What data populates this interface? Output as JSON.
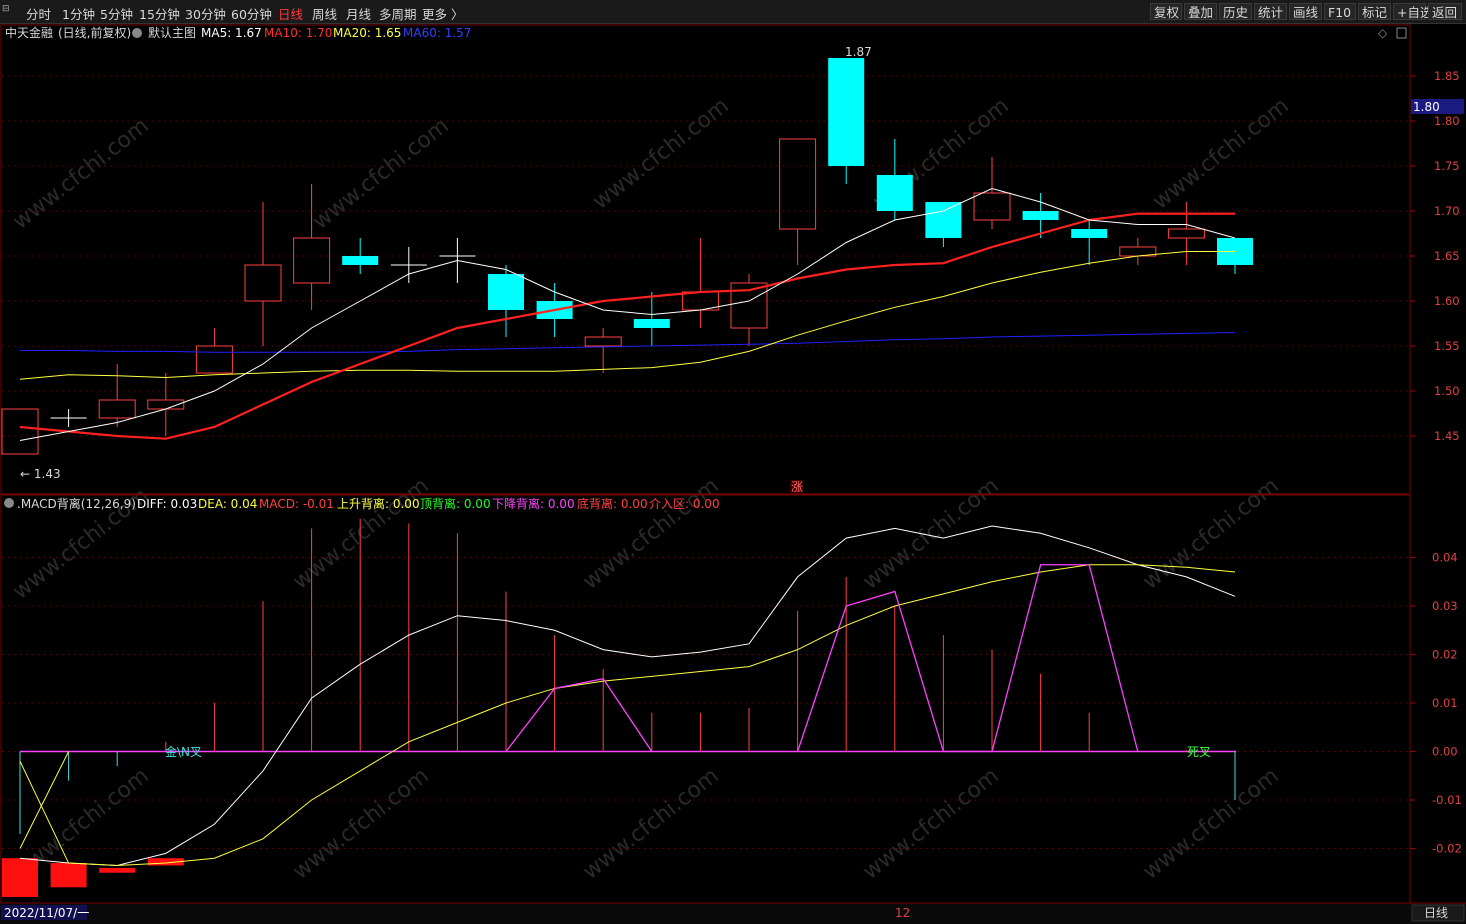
{
  "toolbar": {
    "left_items": [
      "分时",
      "1分钟",
      "5分钟",
      "15分钟",
      "30分钟",
      "60分钟",
      "日线",
      "周线",
      "月线",
      "多周期",
      "更多 〉"
    ],
    "active_item": "日线",
    "right_items": [
      "复权",
      "叠加",
      "历史",
      "统计",
      "画线",
      "F10",
      "标记",
      "+自选",
      "返回"
    ]
  },
  "main_panel": {
    "stock_name": "中天金融",
    "period_note": "(日线,前复权)",
    "template_name": "默认主图",
    "ma5_label": "MA5: 1.67",
    "ma10_label": "MA10: 1.70",
    "ma20_label": "MA20: 1.65",
    "ma60_label": "MA60: 1.57",
    "high_label": "1.87",
    "low_label": "← 1.43",
    "current_price": "1.80",
    "limit_up_mark": "涨",
    "y_ticks": [
      "1.85",
      "1.80",
      "1.75",
      "1.70",
      "1.65",
      "1.60",
      "1.55",
      "1.50",
      "1.45"
    ],
    "colors": {
      "up": "#ff4040",
      "down": "#00ffff",
      "ma5": "#ffffff",
      "ma10": "#ff2020",
      "ma20": "#ffff40",
      "ma60": "#2020ff"
    }
  },
  "macd_panel": {
    "title": ".MACD背离(12,26,9)",
    "diff_label": "DIFF: 0.03",
    "dea_label": "DEA: 0.04",
    "macd_label": "MACD: -0.01",
    "rise_div_label": "上升背离: 0.00",
    "top_div_label": "顶背离: 0.00",
    "fall_div_label": "下降背离: 0.00",
    "bottom_div_label": "底背离: 0.00",
    "entry_label": "介入区: 0.00",
    "golden_cross_text": "金\\N叉",
    "death_cross_text": "死叉",
    "y_ticks": [
      "0.04",
      "0.03",
      "0.02",
      "0.01",
      "0.00",
      "-0.01",
      "-0.02"
    ]
  },
  "bottom_bar": {
    "date_label": "2022/11/07/一",
    "month_label": "12",
    "period_label": "日线"
  },
  "watermark_text": "www.cfchi.com",
  "chart_data": {
    "type": "candlestick",
    "candles": [
      {
        "o": 1.43,
        "c": 1.48,
        "h": 1.48,
        "l": 1.43
      },
      {
        "o": 1.47,
        "c": 1.47,
        "h": 1.48,
        "l": 1.46
      },
      {
        "o": 1.47,
        "c": 1.49,
        "h": 1.53,
        "l": 1.46
      },
      {
        "o": 1.48,
        "c": 1.49,
        "h": 1.52,
        "l": 1.45
      },
      {
        "o": 1.52,
        "c": 1.55,
        "h": 1.57,
        "l": 1.52
      },
      {
        "o": 1.6,
        "c": 1.64,
        "h": 1.71,
        "l": 1.55
      },
      {
        "o": 1.62,
        "c": 1.67,
        "h": 1.73,
        "l": 1.59
      },
      {
        "o": 1.65,
        "c": 1.64,
        "h": 1.67,
        "l": 1.63
      },
      {
        "o": 1.64,
        "c": 1.64,
        "h": 1.66,
        "l": 1.62
      },
      {
        "o": 1.65,
        "c": 1.65,
        "h": 1.67,
        "l": 1.62
      },
      {
        "o": 1.63,
        "c": 1.59,
        "h": 1.64,
        "l": 1.56
      },
      {
        "o": 1.6,
        "c": 1.58,
        "h": 1.62,
        "l": 1.56
      },
      {
        "o": 1.55,
        "c": 1.56,
        "h": 1.57,
        "l": 1.52
      },
      {
        "o": 1.58,
        "c": 1.57,
        "h": 1.61,
        "l": 1.55
      },
      {
        "o": 1.59,
        "c": 1.61,
        "h": 1.67,
        "l": 1.57
      },
      {
        "o": 1.57,
        "c": 1.62,
        "h": 1.63,
        "l": 1.55
      },
      {
        "o": 1.68,
        "c": 1.78,
        "h": 1.78,
        "l": 1.64
      },
      {
        "o": 1.87,
        "c": 1.75,
        "h": 1.87,
        "l": 1.73
      },
      {
        "o": 1.74,
        "c": 1.7,
        "h": 1.78,
        "l": 1.69
      },
      {
        "o": 1.71,
        "c": 1.67,
        "h": 1.71,
        "l": 1.66
      },
      {
        "o": 1.69,
        "c": 1.72,
        "h": 1.76,
        "l": 1.68
      },
      {
        "o": 1.7,
        "c": 1.69,
        "h": 1.72,
        "l": 1.67
      },
      {
        "o": 1.68,
        "c": 1.67,
        "h": 1.69,
        "l": 1.64
      },
      {
        "o": 1.65,
        "c": 1.66,
        "h": 1.67,
        "l": 1.64
      },
      {
        "o": 1.67,
        "c": 1.68,
        "h": 1.71,
        "l": 1.64
      },
      {
        "o": 1.67,
        "c": 1.64,
        "h": 1.67,
        "l": 1.63
      }
    ],
    "ma5": [
      1.445,
      1.455,
      1.465,
      1.48,
      1.5,
      1.53,
      1.57,
      1.6,
      1.63,
      1.645,
      1.635,
      1.61,
      1.59,
      1.585,
      1.59,
      1.6,
      1.63,
      1.665,
      1.69,
      1.7,
      1.725,
      1.71,
      1.69,
      1.685,
      1.685,
      1.67
    ],
    "ma10": [
      1.46,
      1.455,
      1.45,
      1.447,
      1.46,
      1.485,
      1.51,
      1.53,
      1.55,
      1.57,
      1.58,
      1.59,
      1.6,
      1.605,
      1.61,
      1.612,
      1.625,
      1.635,
      1.64,
      1.642,
      1.66,
      1.675,
      1.69,
      1.697,
      1.697,
      1.697
    ],
    "ma20": [
      1.513,
      1.518,
      1.517,
      1.515,
      1.518,
      1.52,
      1.522,
      1.523,
      1.523,
      1.522,
      1.522,
      1.522,
      1.524,
      1.526,
      1.532,
      1.544,
      1.562,
      1.578,
      1.593,
      1.605,
      1.62,
      1.632,
      1.642,
      1.65,
      1.655,
      1.655
    ],
    "ma60": [
      1.545,
      1.545,
      1.544,
      1.544,
      1.543,
      1.543,
      1.543,
      1.543,
      1.544,
      1.546,
      1.547,
      1.548,
      1.549,
      1.55,
      1.551,
      1.552,
      1.553,
      1.555,
      1.557,
      1.558,
      1.56,
      1.561,
      1.562,
      1.563,
      1.564,
      1.565
    ],
    "macd_hist": [
      -0.017,
      -0.006,
      -0.003,
      0.002,
      0.01,
      0.031,
      0.046,
      0.048,
      0.047,
      0.045,
      0.033,
      0.024,
      0.017,
      0.008,
      0.008,
      0.009,
      0.029,
      0.036,
      0.03,
      0.024,
      0.021,
      0.016,
      0.008,
      0.0003,
      0.0003,
      -0.01
    ],
    "macd_diff": [
      -0.022,
      -0.023,
      -0.0235,
      -0.021,
      -0.015,
      -0.004,
      0.011,
      0.018,
      0.024,
      0.028,
      0.027,
      0.025,
      0.021,
      0.0195,
      0.0205,
      0.0222,
      0.036,
      0.044,
      0.046,
      0.044,
      0.0465,
      0.045,
      0.042,
      0.0385,
      0.036,
      0.032
    ],
    "macd_dea": [
      -0.002,
      -0.023,
      -0.0235,
      -0.023,
      -0.022,
      -0.018,
      -0.01,
      -0.004,
      0.002,
      0.006,
      0.01,
      0.013,
      0.0145,
      0.0155,
      0.0165,
      0.0175,
      0.021,
      0.026,
      0.03,
      0.0325,
      0.035,
      0.037,
      0.0385,
      0.0385,
      0.038,
      0.037
    ],
    "divergence_line": [
      null,
      null,
      null,
      null,
      null,
      null,
      null,
      null,
      null,
      null,
      0,
      0.013,
      0.015,
      0,
      null,
      null,
      0,
      0.03,
      0.033,
      0,
      0,
      0.0385,
      0.0385,
      0,
      null,
      null
    ],
    "macd_ylim": [
      -0.03,
      0.05
    ],
    "price_ylim": [
      1.41,
      1.89
    ]
  }
}
